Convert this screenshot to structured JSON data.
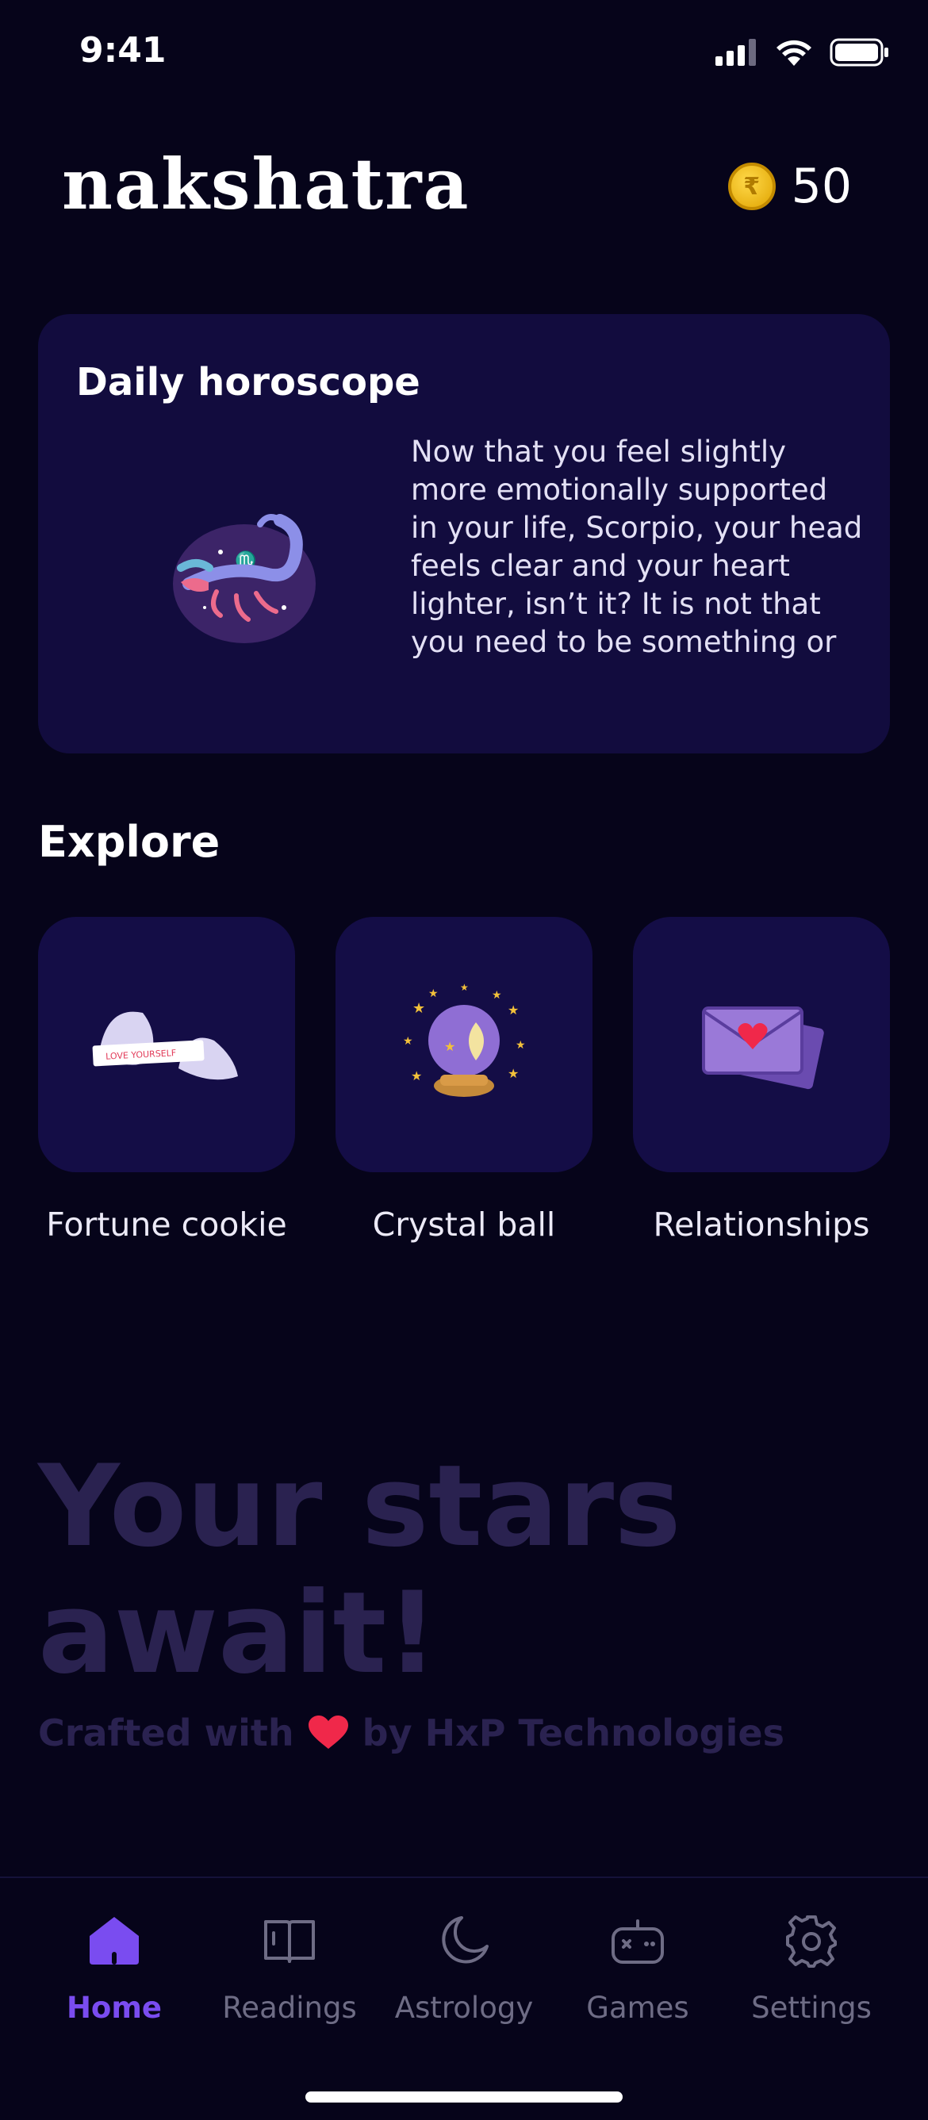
{
  "status_bar": {
    "time": "9:41"
  },
  "header": {
    "logo": "nakshatra",
    "coins": "50"
  },
  "horoscope": {
    "title": "Daily horoscope",
    "text": "Now that you feel slightly more emotionally supported in your life, Scorpio, your head feels clear and your heart lighter, isn’t it? It is not that you need to be something or someone to matter, it is more like you n..."
  },
  "explore": {
    "title": "Explore",
    "items": [
      {
        "label": "Fortune cookie",
        "icon": "fortune-cookie-icon",
        "banner": "LOVE YOURSELF"
      },
      {
        "label": "Crystal ball",
        "icon": "crystal-ball-icon"
      },
      {
        "label": "Relationships",
        "icon": "love-letter-icon"
      }
    ]
  },
  "footer": {
    "tagline_line1": "Your stars",
    "tagline_line2": "await!",
    "crafted_prefix": "Crafted with",
    "crafted_suffix": "by HxP Technologies"
  },
  "tabs": [
    {
      "label": "Home",
      "icon": "home-icon",
      "active": true
    },
    {
      "label": "Readings",
      "icon": "book-icon",
      "active": false
    },
    {
      "label": "Astrology",
      "icon": "moon-icon",
      "active": false
    },
    {
      "label": "Games",
      "icon": "gamepad-icon",
      "active": false
    },
    {
      "label": "Settings",
      "icon": "gear-icon",
      "active": false
    }
  ],
  "colors": {
    "background": "#06041a",
    "card": "#120c3e",
    "tile": "#140d46",
    "accent": "#7a4cf0",
    "muted_text": "#2a2250",
    "heart": "#f0284a",
    "coin": "#ffd94a"
  }
}
